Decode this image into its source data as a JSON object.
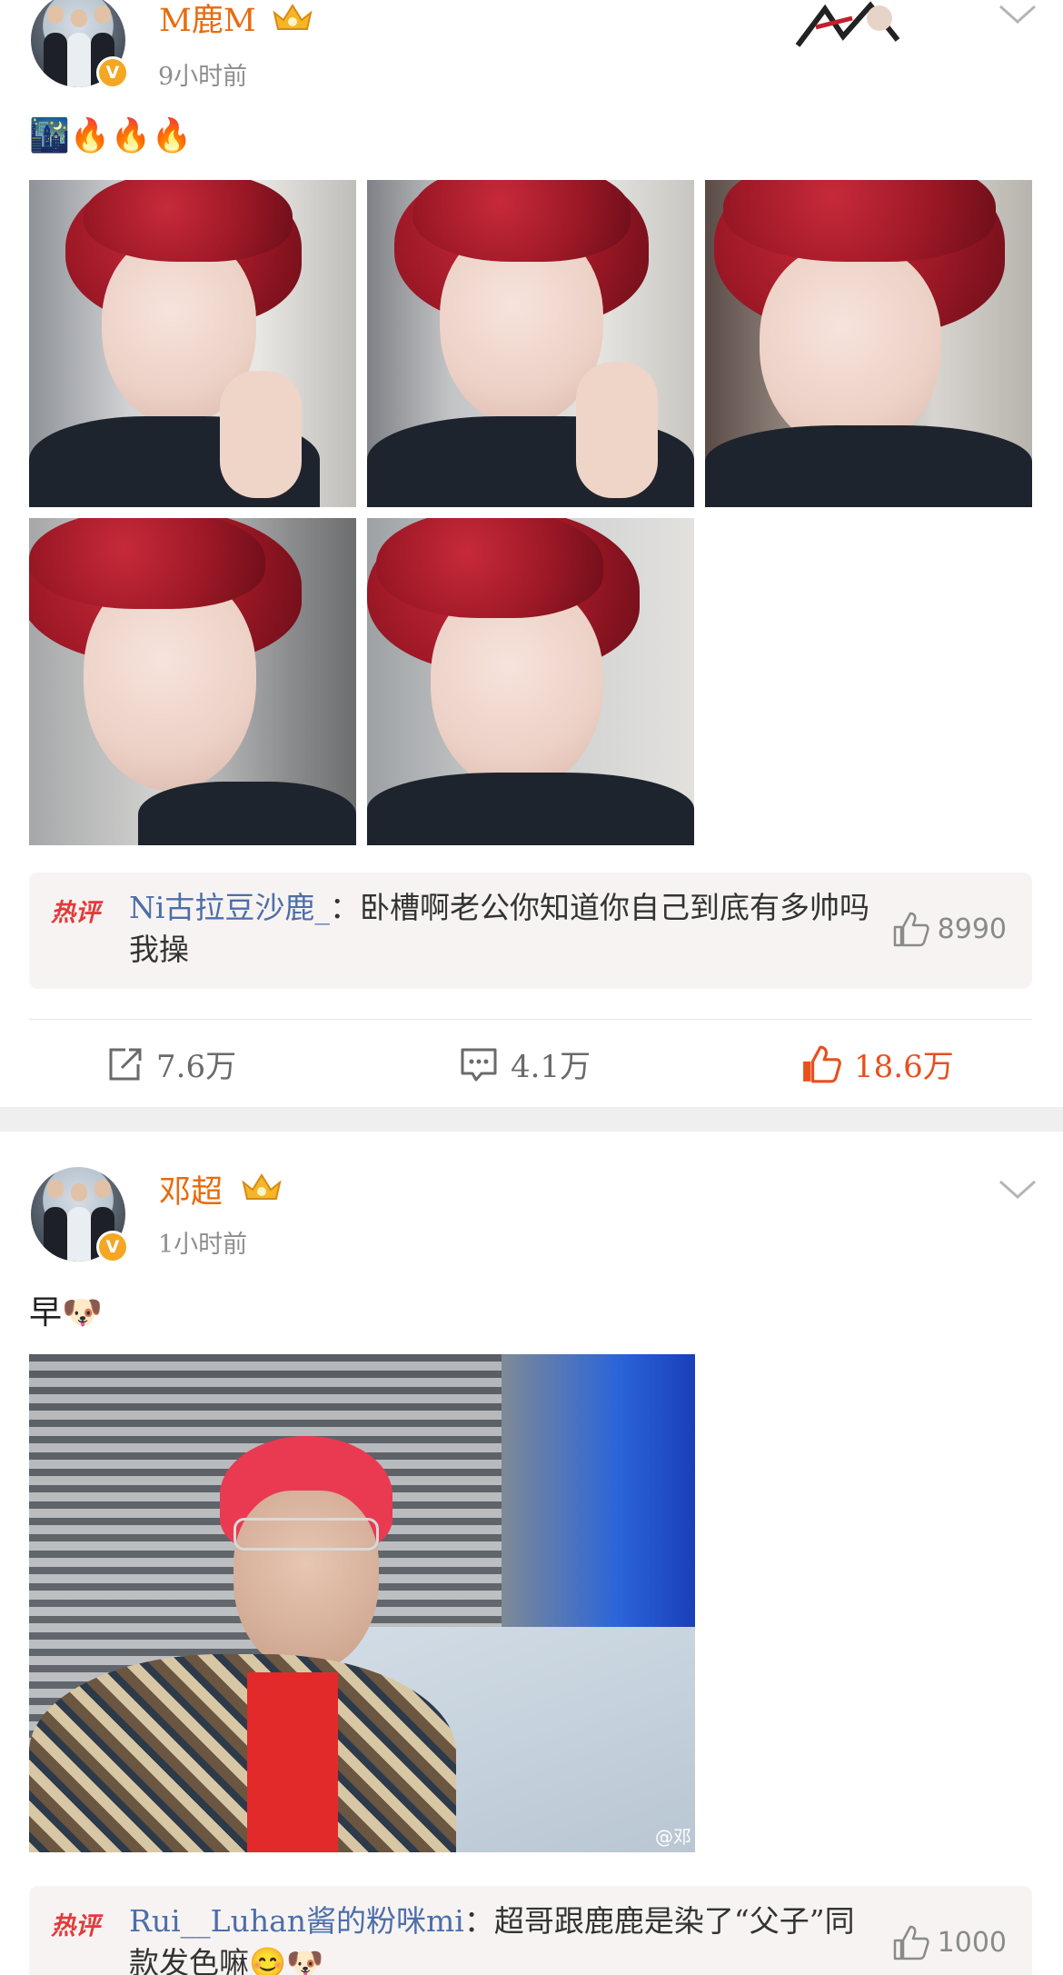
{
  "posts": [
    {
      "username": "M鹿M",
      "timestamp": "9小时前",
      "text": "🌃🔥🔥🔥",
      "hot_comment": {
        "tag": "热评",
        "user": "Ni古拉豆沙鹿_",
        "separator": "：",
        "text": "卧槽啊老公你知道你自己到底有多帅吗我操",
        "likes": "8990"
      },
      "actions": {
        "share": "7.6万",
        "comment": "4.1万",
        "like": "18.6万"
      }
    },
    {
      "username": "邓超",
      "timestamp": "1小时前",
      "text": "早🐶",
      "image_watermark": "@邓",
      "hot_comment": {
        "tag": "热评",
        "user": "Rui__Luhan酱的粉咪mi",
        "separator": "：",
        "text": "超哥跟鹿鹿是染了“父子”同款发色嘛😊🐶",
        "likes": "1000"
      }
    }
  ],
  "colors": {
    "username": "#e86b0d",
    "like_active": "#e8501d",
    "hot_tag": "#e23b3b",
    "comment_user": "#4c6fa8",
    "separator": "#efefef"
  }
}
